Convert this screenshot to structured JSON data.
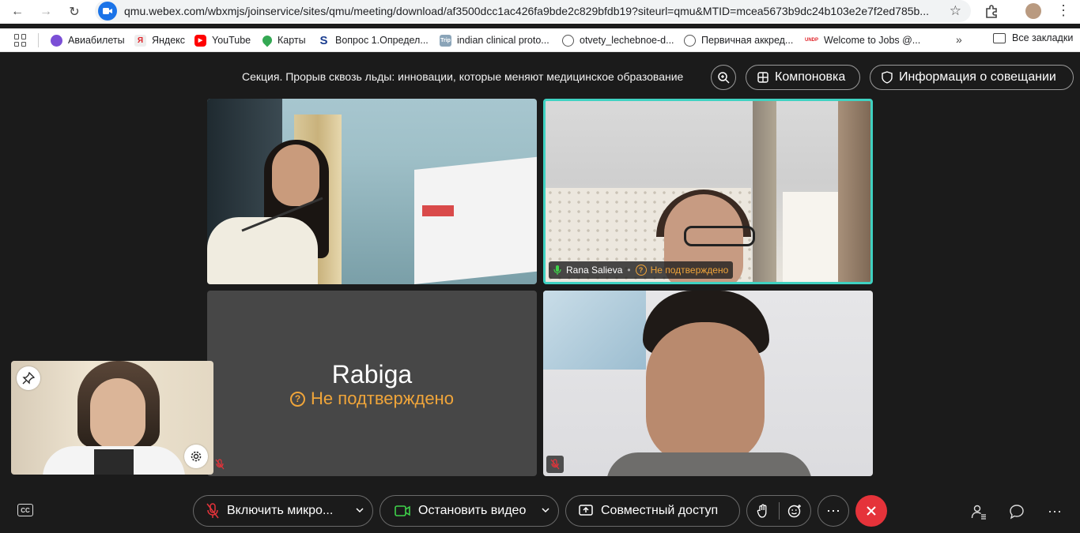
{
  "browser": {
    "url": "qmu.webex.com/wbxmjs/joinservice/sites/qmu/meeting/download/af3500dcc1ac426fa9bde2c829bfdb19?siteurl=qmu&MTID=mcea5673b9dc24b103e2e7f2ed785b...",
    "bookmarks": [
      {
        "label": "Авиабилеты",
        "icon": "aviasales-icon",
        "color": "#7b4fd6"
      },
      {
        "label": "Яндекс",
        "icon": "yandex-icon",
        "color": "#ffffff"
      },
      {
        "label": "YouTube",
        "icon": "youtube-icon",
        "color": "#ff0000"
      },
      {
        "label": "Карты",
        "icon": "maps-pin-icon",
        "color": "#34a853"
      },
      {
        "label": "Вопрос 1.Определ...",
        "icon": "s-logo-icon",
        "color": "#1a3d8f"
      },
      {
        "label": "indian clinical proto...",
        "icon": "trip-icon",
        "color": "#8aa4b8"
      },
      {
        "label": "otvety_lechebnoe-d...",
        "icon": "globe-icon",
        "color": "#555555"
      },
      {
        "label": "Первичная аккред...",
        "icon": "globe-icon",
        "color": "#555555"
      },
      {
        "label": "Welcome to Jobs @...",
        "icon": "jobs-icon",
        "color": "#e0242a"
      }
    ],
    "all_bookmarks": "Все закладки"
  },
  "meeting": {
    "title": "Секция. Прорыв сквозь льды: инновации, которые меняют медицинское образование",
    "layout_label": "Компоновка",
    "info_label": "Информация о совещании",
    "participants": [
      {
        "name": "Rana Salieva",
        "status": "Не подтверждено",
        "active_speaker": true
      },
      {
        "name": "Rabiga",
        "status": "Не подтверждено",
        "video": false
      }
    ]
  },
  "controls": {
    "mic_label": "Включить микро...",
    "video_label": "Остановить видео",
    "share_label": "Совместный доступ",
    "end_color": "#e5333a"
  },
  "colors": {
    "accent": "#3fd2c2",
    "warning": "#f0a53a",
    "background": "#1b1b1b"
  }
}
